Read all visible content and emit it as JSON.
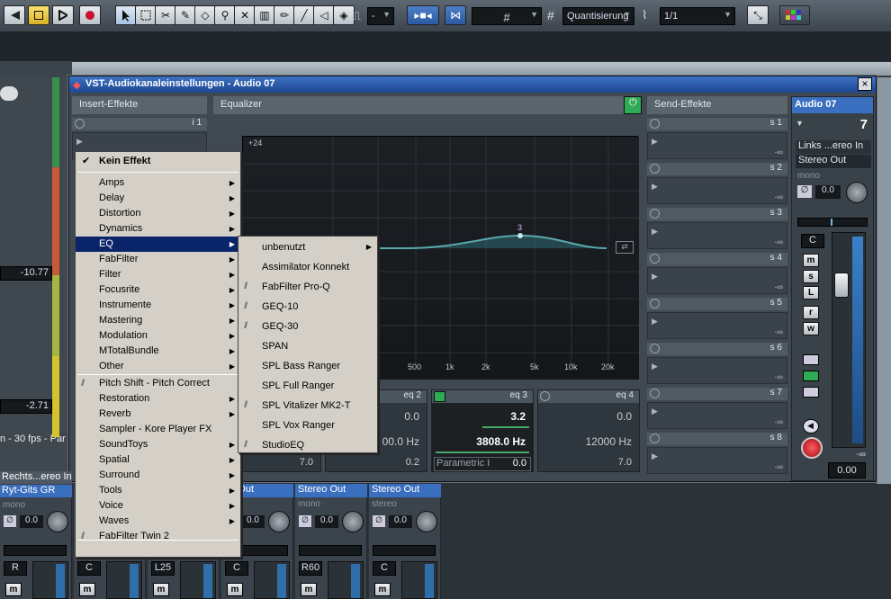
{
  "toolbar": {
    "quantize_label": "Quantisierung",
    "quantize_value": "1/1",
    "quantize_dash": "-"
  },
  "window": {
    "title": "VST-Audiokanaleinstellungen - Audio 07",
    "close": "×"
  },
  "panels": {
    "insert": "Insert-Effekte",
    "equalizer": "Equalizer",
    "sends": "Send-Effekte",
    "channel_name": "Audio 07",
    "channel_number": "7"
  },
  "insert_slot1": "i 1",
  "sends": [
    "s 1",
    "s 2",
    "s 3",
    "s 4",
    "s 5",
    "s 6",
    "s 7",
    "s 8"
  ],
  "send_dash": "-∞",
  "eq_graph": {
    "top_label": "+24",
    "freq_labels": [
      "500",
      "1k",
      "2k",
      "5k",
      "10k",
      "20k"
    ],
    "point_label": "3"
  },
  "eq_bands": [
    {
      "name": "eq 2",
      "gain": "0.0",
      "freq": "00.0 Hz",
      "q": "0.2"
    },
    {
      "name": "eq 3",
      "gain": "3.2",
      "freq": "3808.0 Hz",
      "mode": "Parametric I",
      "q": "0.0"
    },
    {
      "name": "eq 4",
      "gain": "0.0",
      "freq": "12000 Hz",
      "q": "7.0"
    }
  ],
  "eq_band1_q": "7.0",
  "channel_strip": {
    "input": "Links ...ereo In",
    "output": "Stereo Out",
    "mono": "mono",
    "phase_value": "0.0",
    "pan": "C",
    "buttons": [
      "m",
      "s",
      "L",
      "r",
      "w"
    ],
    "fader_value": "0.00",
    "meter_peak": "-∞"
  },
  "tracks": {
    "volume1": "-10.77",
    "volume2": "-2.71",
    "fps": "n - 30 fps - Par"
  },
  "mixer": [
    {
      "name": "Rechts...ereo In",
      "sub": "Ryt-Gits GR",
      "mono": "mono",
      "phase": "0.0",
      "pan": "R"
    },
    {
      "name": "",
      "sub": "",
      "mono": "",
      "phase": "",
      "pan": "C"
    },
    {
      "name": "",
      "sub": "",
      "mono": "",
      "phase": "",
      "pan": "L25"
    },
    {
      "name": "eo Out",
      "sub": "",
      "mono": "",
      "phase": "0.0",
      "pan": "C"
    },
    {
      "name": "Stereo Out",
      "sub": "",
      "mono": "mono",
      "phase": "0.0",
      "pan": "R60"
    },
    {
      "name": "Stereo Out",
      "sub": "",
      "mono": "stereo",
      "phase": "0.0",
      "pan": "C"
    }
  ],
  "menu_main": {
    "header": "Kein Effekt",
    "items": [
      {
        "label": "Amps",
        "sub": true
      },
      {
        "label": "Delay",
        "sub": true
      },
      {
        "label": "Distortion",
        "sub": true
      },
      {
        "label": "Dynamics",
        "sub": true
      },
      {
        "label": "EQ",
        "sub": true,
        "highlight": true
      },
      {
        "label": "FabFilter",
        "sub": true
      },
      {
        "label": "Filter",
        "sub": true
      },
      {
        "label": "Focusrite",
        "sub": true
      },
      {
        "label": "Instrumente",
        "sub": true
      },
      {
        "label": "Mastering",
        "sub": true
      },
      {
        "label": "Modulation",
        "sub": true
      },
      {
        "label": "MTotalBundle",
        "sub": true
      },
      {
        "label": "Other",
        "sub": true
      },
      {
        "label": "Pitch Shift - Pitch Correct",
        "sub": false,
        "plugin": true
      },
      {
        "label": "Restoration",
        "sub": true
      },
      {
        "label": "Reverb",
        "sub": true
      },
      {
        "label": "Sampler - Kore Player FX",
        "sub": false
      },
      {
        "label": "SoundToys",
        "sub": true
      },
      {
        "label": "Spatial",
        "sub": true
      },
      {
        "label": "Surround",
        "sub": true
      },
      {
        "label": "Tools",
        "sub": true
      },
      {
        "label": "Voice",
        "sub": true
      },
      {
        "label": "Waves",
        "sub": true
      },
      {
        "label": "FabFilter Twin 2",
        "sub": false,
        "plugin": true
      }
    ]
  },
  "menu_eq": {
    "items": [
      {
        "label": "unbenutzt",
        "sub": true
      },
      {
        "label": "Assimilator Konnekt"
      },
      {
        "label": "FabFilter Pro-Q",
        "plugin": true
      },
      {
        "label": "GEQ-10",
        "plugin": true
      },
      {
        "label": "GEQ-30",
        "plugin": true
      },
      {
        "label": "SPAN"
      },
      {
        "label": "SPL Bass Ranger"
      },
      {
        "label": "SPL Full Ranger"
      },
      {
        "label": "SPL Vitalizer MK2-T",
        "plugin": true
      },
      {
        "label": "SPL Vox Ranger"
      },
      {
        "label": "StudioEQ",
        "plugin": true
      }
    ]
  }
}
